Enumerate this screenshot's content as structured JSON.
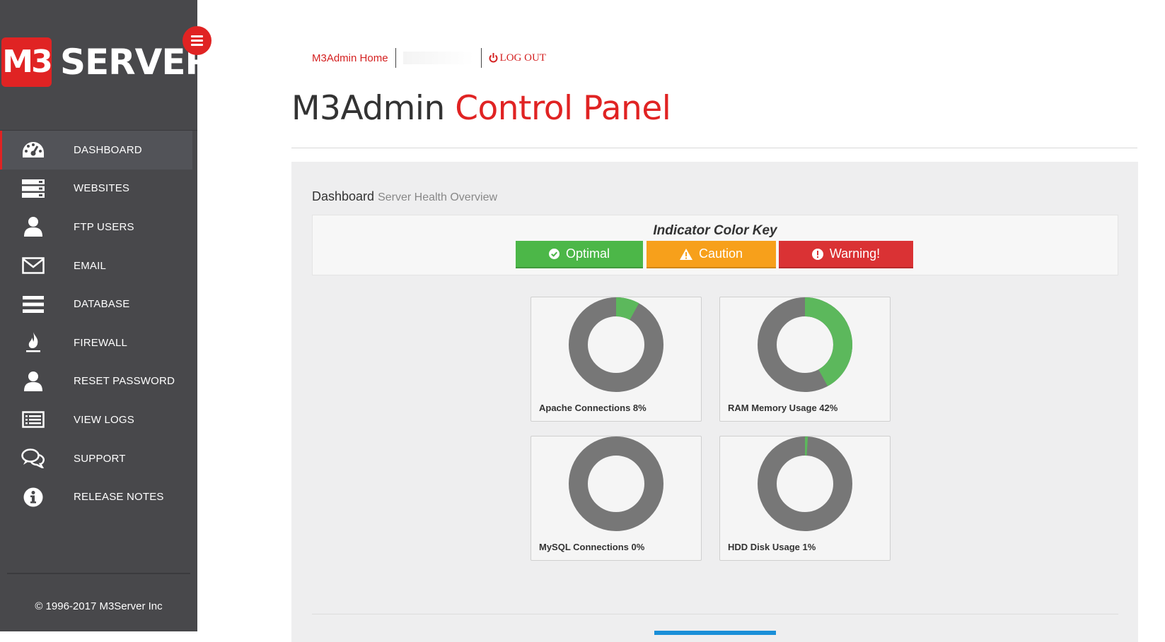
{
  "brand": {
    "logo_mark": "M3",
    "logo_text": "SERVER",
    "accent": "#e02323"
  },
  "sidebar": {
    "items": [
      {
        "label": "DASHBOARD",
        "icon": "dashboard-icon",
        "active": true
      },
      {
        "label": "WEBSITES",
        "icon": "server-icon"
      },
      {
        "label": "FTP USERS",
        "icon": "user-icon"
      },
      {
        "label": "EMAIL",
        "icon": "envelope-icon"
      },
      {
        "label": "DATABASE",
        "icon": "list-icon"
      },
      {
        "label": "FIREWALL",
        "icon": "fire-icon"
      },
      {
        "label": "RESET PASSWORD",
        "icon": "user-icon"
      },
      {
        "label": "VIEW LOGS",
        "icon": "log-list-icon"
      },
      {
        "label": "SUPPORT",
        "icon": "chat-bubbles-icon"
      },
      {
        "label": "RELEASE NOTES",
        "icon": "info-icon"
      }
    ],
    "copyright": "© 1996-2017 M3Server Inc"
  },
  "topnav": {
    "home_label": "M3Admin Home",
    "logout_label": "LOG OUT"
  },
  "page": {
    "title_main": "M3Admin ",
    "title_accent": "Control Panel"
  },
  "panel": {
    "heading": "Dashboard",
    "subheading": "Server Health Overview",
    "key": {
      "title": "Indicator Color Key",
      "optimal": "Optimal",
      "caution": "Caution",
      "warning": "Warning!"
    }
  },
  "colors": {
    "optimal": "#4cb748",
    "caution": "#f7a01b",
    "warning": "#da3234",
    "gauge_track": "#777777",
    "gauge_fill": "#5cb85c"
  },
  "gauges": [
    {
      "label": "Apache Connections 8%",
      "percent": 8
    },
    {
      "label": "RAM Memory Usage 42%",
      "percent": 42
    },
    {
      "label": "MySQL Connections 0%",
      "percent": 0
    },
    {
      "label": "HDD Disk Usage 1%",
      "percent": 1
    }
  ]
}
